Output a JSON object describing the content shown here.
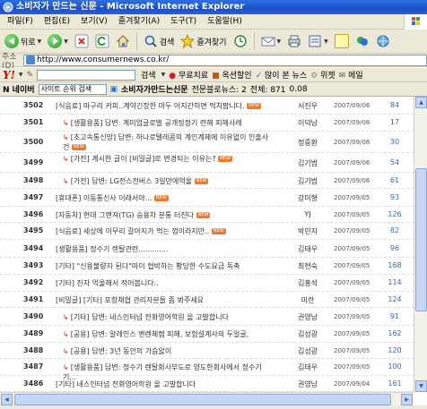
{
  "window": {
    "title": "소비자가 만드는 신문 - Microsoft Internet Explorer"
  },
  "menu": {
    "items": [
      "파일(F)",
      "편집(E)",
      "보기(V)",
      "즐겨찾기(A)",
      "도구(T)",
      "도움말(H)"
    ]
  },
  "toolbar": {
    "back_label": "뒤로",
    "search_label": "검색",
    "favorites_label": "즐겨찾기"
  },
  "address": {
    "label": "주소(D)",
    "url": "http://www.consumernews.co.kr/"
  },
  "yahoo_bar": {
    "logo": "Y!",
    "search_label": "검색",
    "items": [
      "무료치료",
      "옥션할인",
      "많이 본 뉴스",
      "위젯",
      "메일"
    ]
  },
  "naver_bar": {
    "logo": "N 네이버",
    "search_value": "사이트 순위 검색",
    "site_label": "소비자가만드는신문",
    "popularity_label": "전문블로뉴스: 2",
    "total_label": "전체: 871",
    "score_label": "0.08"
  },
  "badge_new": "NEW",
  "posts": [
    {
      "num": "3502",
      "title": "[식음료] 마구리 커피..계약긴장한 마두 어지간히면 먹치팝니다.",
      "reply": false,
      "new": true,
      "author": "서진우",
      "date": "2007/09/06",
      "hits": "84"
    },
    {
      "num": "3501",
      "title": "[생활용품] 답변: 계미엄글로벌 공개정정기 련해 피해사례",
      "reply": true,
      "new": false,
      "author": "이덕남",
      "date": "2007/09/06",
      "hits": "17"
    },
    {
      "num": "3500",
      "title": "[초고속통신망] 답변: 하나로텔레콤의 계인계제에 이유없이 인출사건",
      "reply": true,
      "new": true,
      "author": "정중환",
      "date": "2007/09/06",
      "hits": "30"
    },
    {
      "num": "3499",
      "title": "[가전] 계시한 글이 [비밀글]로 변경되는 이유는?",
      "reply": true,
      "new": true,
      "author": "김기범",
      "date": "2007/09/06",
      "hits": "54"
    },
    {
      "num": "3498",
      "title": "[가전] 답변: LG전스전버스 3일만에억울",
      "reply": true,
      "new": true,
      "author": "김기범",
      "date": "2007/09/06",
      "hits": "61"
    },
    {
      "num": "3497",
      "title": "[휴대폰] 이동통신사 이래서야...",
      "reply": false,
      "new": true,
      "author": "강미형",
      "date": "2007/09/05",
      "hits": "93"
    },
    {
      "num": "3496",
      "title": "[자동차] 현대 그랜져(TG) 승용차 분통 터진다",
      "reply": false,
      "new": true,
      "author": "YJ",
      "date": "2007/09/05",
      "hits": "126"
    },
    {
      "num": "3495",
      "title": "[식음료] 세상에 이무리 갈아지가 먹는 껌이라지만..",
      "reply": false,
      "new": true,
      "author": "박민지",
      "date": "2007/09/05",
      "hits": "82"
    },
    {
      "num": "3494",
      "title": "[생활용품] 정수기 렌탈관련.............",
      "reply": false,
      "new": false,
      "author": "김태우",
      "date": "2007/09/05",
      "hits": "96"
    },
    {
      "num": "3493",
      "title": "[기타] \"신용불량자 된다\"마이 협박하는 황당한 수도요금 독촉",
      "reply": false,
      "new": false,
      "author": "최현숙",
      "date": "2007/09/05",
      "hits": "168"
    },
    {
      "num": "3492",
      "title": "[기타] 진자 억울해서 적어봅니다..",
      "reply": false,
      "new": false,
      "author": "김홍석",
      "date": "2007/09/05",
      "hits": "114"
    },
    {
      "num": "3491",
      "title": "[비밀글] [기타] 포항채협 관리자분들 좀 봐주세요",
      "reply": false,
      "new": false,
      "author": "미란",
      "date": "2007/09/05",
      "hits": "124"
    },
    {
      "num": "3490",
      "title": "[기타] 답변: 네스인터넘 전화영어학원 을 고발합니다",
      "reply": true,
      "new": false,
      "author": "권영남",
      "date": "2007/09/05",
      "hits": "91"
    },
    {
      "num": "3489",
      "title": "[공용] 답변: 알레인스 밴렌체캠 피해, 보험설계사의 두얼굴,",
      "reply": true,
      "new": false,
      "author": "김성광",
      "date": "2007/09/05",
      "hits": "162"
    },
    {
      "num": "3488",
      "title": "[공용] 답변: 3년 동안의 가슴앓이",
      "reply": true,
      "new": false,
      "author": "김성광",
      "date": "2007/09/05",
      "hits": "120"
    },
    {
      "num": "3487",
      "title": "[생활용품] 답변: 정수기 렌탈회사부도로 양도한회사에서 정수기 기...",
      "reply": true,
      "new": false,
      "author": "김태우",
      "date": "2007/09/05",
      "hits": "100"
    },
    {
      "num": "3486",
      "title": "[기타] 네스인터넘 전화영어학원 을 고발합니다",
      "reply": false,
      "new": false,
      "author": "권영남",
      "date": "2007/09/04",
      "hits": "161"
    }
  ]
}
